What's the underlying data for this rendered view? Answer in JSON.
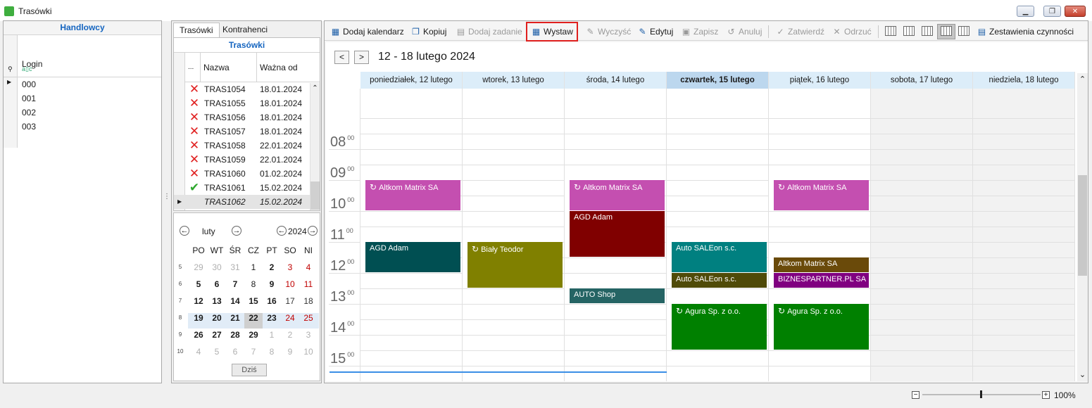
{
  "window": {
    "title": "Trasówki",
    "min": "▁",
    "max": "❐",
    "close": "✕"
  },
  "handlowcy": {
    "header": "Handlowcy",
    "column": "Login",
    "filter_icon": "funnel-icon",
    "filter_text": "a▯c",
    "rows": [
      "000",
      "001",
      "002",
      "003"
    ]
  },
  "middle": {
    "tabs": [
      "Trasówki",
      "Kontrahenci"
    ],
    "grid_header": "Trasówki",
    "columns": [
      "...",
      "Nazwa",
      "Ważna od"
    ],
    "rows": [
      {
        "status": "x",
        "name": "TRAS1054",
        "date": "18.01.2024"
      },
      {
        "status": "x",
        "name": "TRAS1055",
        "date": "18.01.2024"
      },
      {
        "status": "x",
        "name": "TRAS1056",
        "date": "18.01.2024"
      },
      {
        "status": "x",
        "name": "TRAS1057",
        "date": "18.01.2024"
      },
      {
        "status": "x",
        "name": "TRAS1058",
        "date": "22.01.2024"
      },
      {
        "status": "x",
        "name": "TRAS1059",
        "date": "22.01.2024"
      },
      {
        "status": "x",
        "name": "TRAS1060",
        "date": "01.02.2024"
      },
      {
        "status": "ok",
        "name": "TRAS1061",
        "date": "15.02.2024"
      },
      {
        "status": "",
        "name": "TRAS1062",
        "date": "15.02.2024"
      }
    ],
    "calendar": {
      "month": "luty",
      "year": "2024",
      "weekdays": [
        "PO",
        "WT",
        "ŚR",
        "CZ",
        "PT",
        "SO",
        "NI"
      ],
      "weeks": [
        {
          "wk": "5",
          "days": [
            "29",
            "30",
            "31",
            "1",
            "2",
            "3",
            "4"
          ]
        },
        {
          "wk": "6",
          "days": [
            "5",
            "6",
            "7",
            "8",
            "9",
            "10",
            "11"
          ]
        },
        {
          "wk": "7",
          "days": [
            "12",
            "13",
            "14",
            "15",
            "16",
            "17",
            "18"
          ]
        },
        {
          "wk": "8",
          "days": [
            "19",
            "20",
            "21",
            "22",
            "23",
            "24",
            "25"
          ]
        },
        {
          "wk": "9",
          "days": [
            "26",
            "27",
            "28",
            "29",
            "1",
            "2",
            "3"
          ]
        },
        {
          "wk": "10",
          "days": [
            "4",
            "5",
            "6",
            "7",
            "8",
            "9",
            "10"
          ]
        }
      ],
      "today_button": "Dziś"
    }
  },
  "toolbar": {
    "dodaj_kalendarz": "Dodaj kalendarz",
    "kopiuj": "Kopiuj",
    "dodaj_zadanie": "Dodaj zadanie",
    "wystaw": "Wystaw",
    "wyczysc": "Wyczyść",
    "edytuj": "Edytuj",
    "zapisz": "Zapisz",
    "anuluj": "Anuluj",
    "zatwierdz": "Zatwierdź",
    "odrzuc": "Odrzuć",
    "zestawienia": "Zestawienia czynności"
  },
  "scheduler": {
    "range": "12 - 18 lutego 2024",
    "prev": "<",
    "next": ">",
    "days": [
      "poniedziałek, 12 lutego",
      "wtorek, 13 lutego",
      "środa, 14 lutego",
      "czwartek, 15 lutego",
      "piątek, 16 lutego",
      "sobota, 17 lutego",
      "niedziela, 18 lutego"
    ],
    "today_index": 3,
    "hours": [
      "08",
      "09",
      "10",
      "11",
      "12",
      "13",
      "14",
      "15"
    ],
    "minutes": "00",
    "events": [
      {
        "day": 0,
        "start": "09:00",
        "end": "10:00",
        "title": "Altkom Matrix SA",
        "color": "#c44fb0",
        "recurring": true
      },
      {
        "day": 2,
        "start": "09:00",
        "end": "10:00",
        "title": "Altkom Matrix SA",
        "color": "#c44fb0",
        "recurring": true
      },
      {
        "day": 4,
        "start": "09:00",
        "end": "10:00",
        "title": "Altkom Matrix SA",
        "color": "#c44fb0",
        "recurring": true
      },
      {
        "day": 2,
        "start": "10:00",
        "end": "11:30",
        "title": "AGD Adam",
        "color": "#800000",
        "recurring": false
      },
      {
        "day": 0,
        "start": "11:00",
        "end": "12:00",
        "title": "AGD Adam",
        "color": "#004f52",
        "recurring": false
      },
      {
        "day": 1,
        "start": "11:00",
        "end": "12:30",
        "title": "Biały Teodor",
        "color": "#808000",
        "recurring": true
      },
      {
        "day": 3,
        "start": "11:00",
        "end": "12:00",
        "title": "Auto SALEon s.c.",
        "color": "#008080",
        "recurring": false
      },
      {
        "day": 4,
        "start": "11:30",
        "end": "12:00",
        "title": "Altkom Matrix SA",
        "color": "#6a4a0a",
        "recurring": false
      },
      {
        "day": 3,
        "start": "12:00",
        "end": "12:30",
        "title": "Auto SALEon s.c.",
        "color": "#4f4a08",
        "recurring": false
      },
      {
        "day": 4,
        "start": "12:00",
        "end": "12:30",
        "title": "BIZNESPARTNER.PL SA",
        "color": "#800080",
        "recurring": false
      },
      {
        "day": 2,
        "start": "12:30",
        "end": "13:00",
        "title": "AUTO Shop",
        "color": "#256464",
        "recurring": false
      },
      {
        "day": 3,
        "start": "13:00",
        "end": "14:30",
        "title": "Agura Sp. z o.o.",
        "color": "#008000",
        "recurring": true
      },
      {
        "day": 4,
        "start": "13:00",
        "end": "14:30",
        "title": "Agura Sp. z o.o.",
        "color": "#008000",
        "recurring": true
      }
    ]
  },
  "status": {
    "zoom": "100%",
    "zoom_out": "−",
    "zoom_in": "+"
  }
}
